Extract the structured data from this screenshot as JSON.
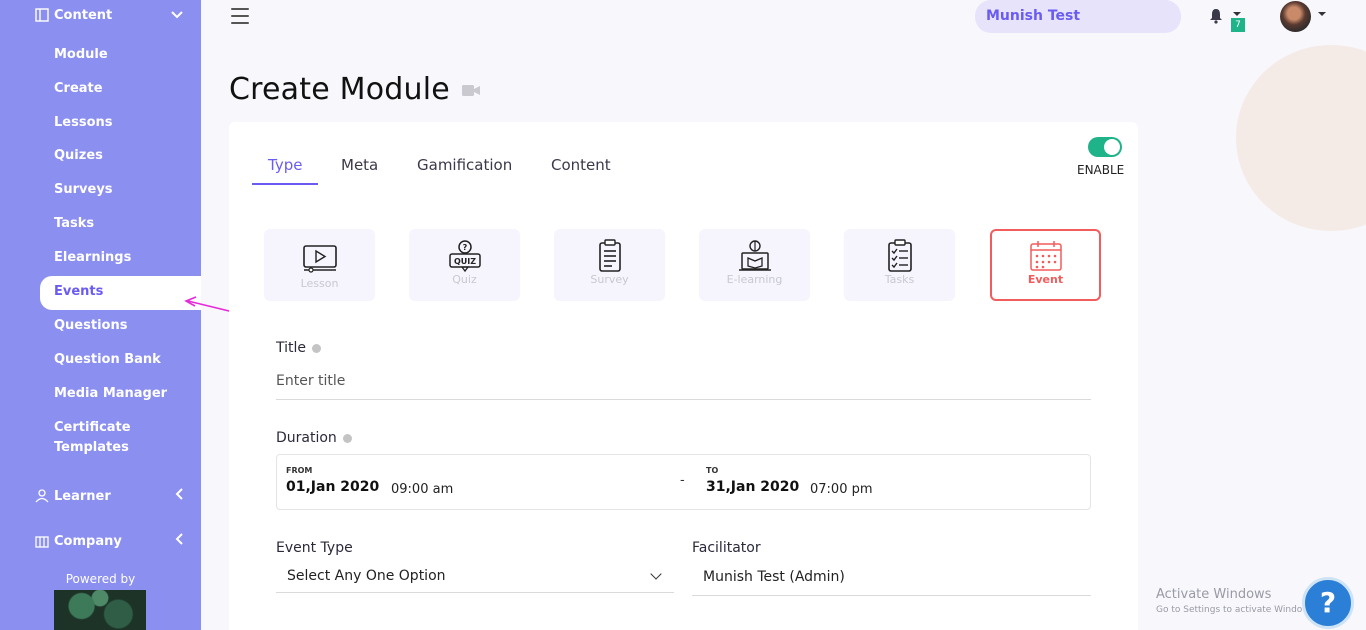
{
  "sidebar": {
    "content_group": "Content",
    "items": [
      {
        "label": "Module"
      },
      {
        "label": "Create"
      },
      {
        "label": "Lessons"
      },
      {
        "label": "Quizes"
      },
      {
        "label": "Surveys"
      },
      {
        "label": "Tasks"
      },
      {
        "label": "Elearnings"
      },
      {
        "label": "Events",
        "active": true
      },
      {
        "label": "Questions"
      },
      {
        "label": "Question Bank"
      },
      {
        "label": "Media Manager"
      },
      {
        "label": "Certificate Templates"
      }
    ],
    "learner_group": "Learner",
    "company_group": "Company",
    "powered_by": "Powered by"
  },
  "topbar": {
    "user_name": "Munish Test",
    "notification_count": "7"
  },
  "page": {
    "title": "Create Module"
  },
  "tabs": [
    {
      "label": "Type",
      "active": true
    },
    {
      "label": "Meta"
    },
    {
      "label": "Gamification"
    },
    {
      "label": "Content"
    }
  ],
  "toggle": {
    "label": "ENABLE",
    "on": true
  },
  "module_types": [
    {
      "label": "Lesson",
      "icon": "video-lesson-icon"
    },
    {
      "label": "Quiz",
      "icon": "quiz-icon"
    },
    {
      "label": "Survey",
      "icon": "survey-clipboard-icon"
    },
    {
      "label": "E-learning",
      "icon": "elearning-icon"
    },
    {
      "label": "Tasks",
      "icon": "tasks-checklist-icon"
    },
    {
      "label": "Event",
      "icon": "calendar-icon",
      "selected": true
    }
  ],
  "form": {
    "title_label": "Title",
    "title_placeholder": "Enter title",
    "duration_label": "Duration",
    "from_label": "FROM",
    "from_date": "01,Jan 2020",
    "from_time": "09:00 am",
    "separator": "-",
    "to_label": "TO",
    "to_date": "31,Jan 2020",
    "to_time": "07:00 pm",
    "event_type_label": "Event Type",
    "event_type_value": "Select Any One Option",
    "facilitator_label": "Facilitator",
    "facilitator_value": "Munish Test (Admin)"
  },
  "watermark": {
    "title": "Activate Windows",
    "subtitle": "Go to Settings to activate Windows."
  },
  "help_button": "?",
  "colors": {
    "sidebar": "#8b8ff0",
    "accent": "#6a5cf0",
    "toggle": "#1fb38a",
    "selected_border": "#f25c5c",
    "annotation_arrow": "#e62ad9"
  }
}
